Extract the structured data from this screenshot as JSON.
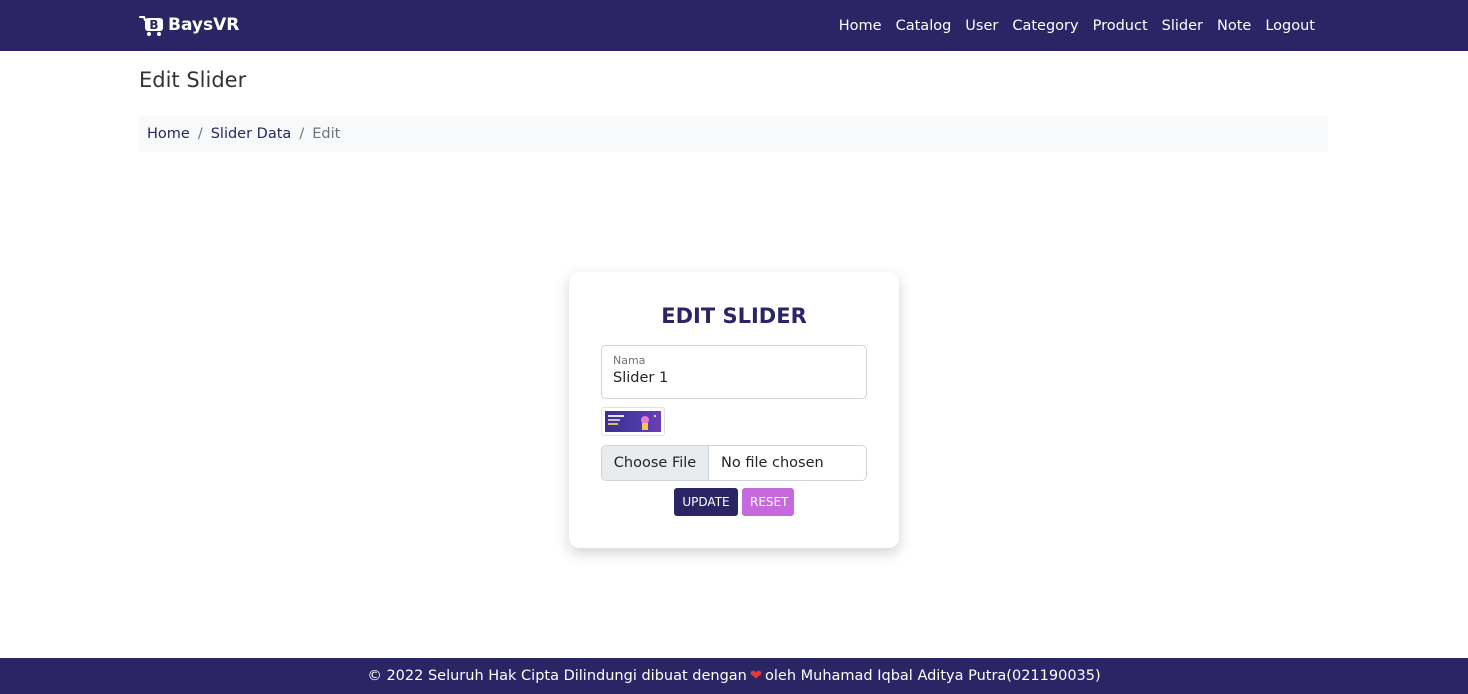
{
  "navbar": {
    "brand": "BaysVR",
    "links": [
      "Home",
      "Catalog",
      "User",
      "Category",
      "Product",
      "Slider",
      "Note",
      "Logout"
    ]
  },
  "page": {
    "title": "Edit Slider"
  },
  "breadcrumb": {
    "home": "Home",
    "slider_data": "Slider Data",
    "current": "Edit",
    "separator": "/"
  },
  "form": {
    "title": "EDIT SLIDER",
    "nama_label": "Nama",
    "nama_value": "Slider 1",
    "file_button": "Choose File",
    "file_status": "No file chosen",
    "update_label": "UPDATE",
    "reset_label": "RESET"
  },
  "footer": {
    "text_before": "© 2022 Seluruh Hak Cipta Dilindungi dibuat dengan",
    "heart": "❤",
    "text_after": "oleh Muhamad Iqbal Aditya Putra(021190035)"
  },
  "colors": {
    "primary": "#2b2566",
    "reset": "#c569dd",
    "heart": "#e53935"
  }
}
